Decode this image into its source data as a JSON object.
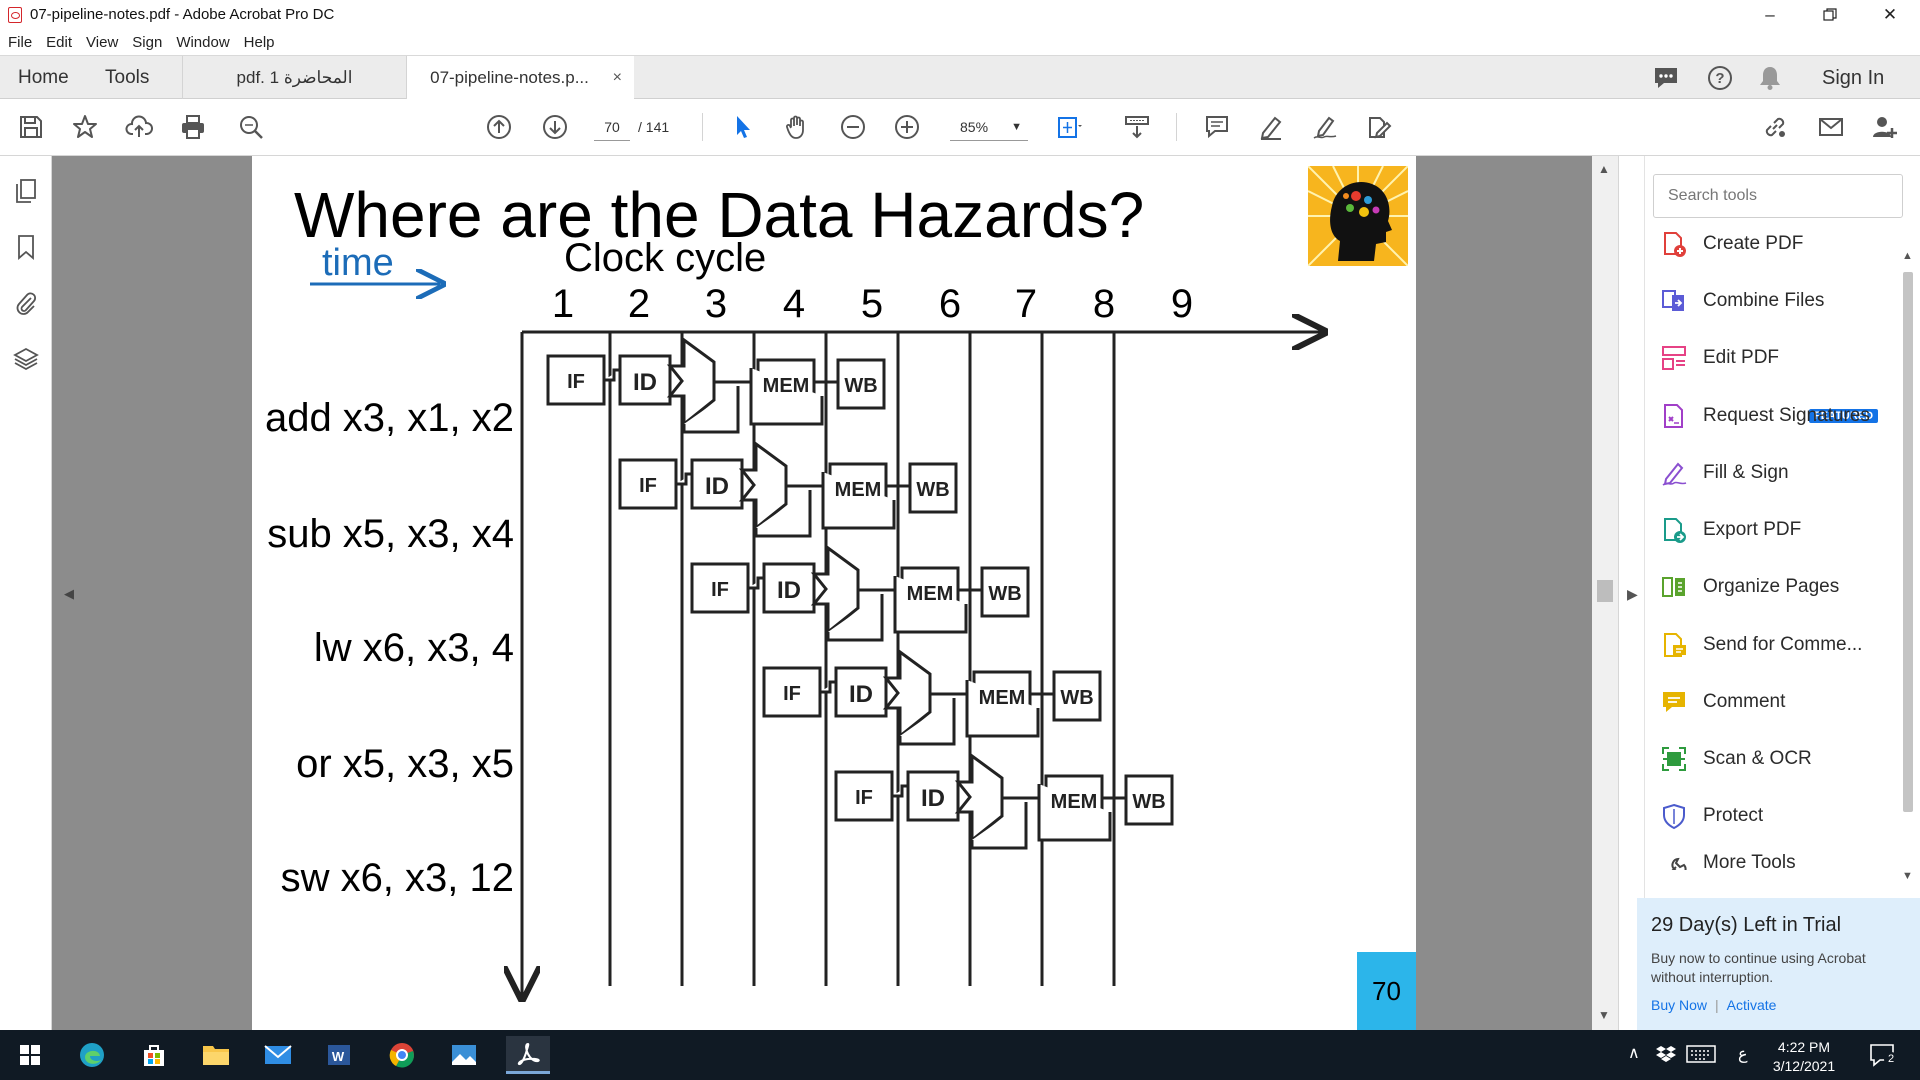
{
  "window": {
    "title": "07-pipeline-notes.pdf - Adobe Acrobat Pro DC"
  },
  "menu": [
    "File",
    "Edit",
    "View",
    "Sign",
    "Window",
    "Help"
  ],
  "tabs": {
    "home": "Home",
    "tools": "Tools",
    "doc1": "pdf. المحاضرة 1",
    "doc2": "07-pipeline-notes.p...",
    "close_glyph": "×",
    "sign_in": "Sign In"
  },
  "toolbar": {
    "page_current": "70",
    "page_total": "/ 141",
    "zoom": "85%"
  },
  "slide": {
    "title": "Where are the Data Hazards?",
    "time_label": "time",
    "clock_label": "Clock cycle",
    "cycles": [
      "1",
      "2",
      "3",
      "4",
      "5",
      "6",
      "7",
      "8",
      "9"
    ],
    "instructions": [
      "add x3, x1, x2",
      "sub x5, x3, x4",
      "lw x6, x3, 4",
      "or x5, x3, x5",
      "sw x6, x3, 12"
    ],
    "stages": {
      "if": "IF",
      "id": "ID",
      "mem": "MEM",
      "wb": "WB"
    },
    "page_number": "70"
  },
  "right_panel": {
    "search_placeholder": "Search tools",
    "featured_badge": "FEATURED",
    "tools": [
      {
        "label": "Create PDF",
        "icon": "create-pdf-icon",
        "color": "#e0403b"
      },
      {
        "label": "Combine Files",
        "icon": "combine-files-icon",
        "color": "#5b5bd6"
      },
      {
        "label": "Edit PDF",
        "icon": "edit-pdf-icon",
        "color": "#e64285"
      },
      {
        "label": "Request Signatures",
        "icon": "request-signatures-icon",
        "color": "#a13fc8"
      },
      {
        "label": "Fill & Sign",
        "icon": "fill-sign-icon",
        "color": "#8a4fd0"
      },
      {
        "label": "Export PDF",
        "icon": "export-pdf-icon",
        "color": "#1a9b8a"
      },
      {
        "label": "Organize Pages",
        "icon": "organize-pages-icon",
        "color": "#5aa32d"
      },
      {
        "label": "Send for Comme...",
        "icon": "send-for-comment-icon",
        "color": "#e6b400"
      },
      {
        "label": "Comment",
        "icon": "comment-icon",
        "color": "#e6b400"
      },
      {
        "label": "Scan & OCR",
        "icon": "scan-ocr-icon",
        "color": "#2e9b3e"
      },
      {
        "label": "Protect",
        "icon": "protect-icon",
        "color": "#4b5bcc"
      },
      {
        "label": "More Tools",
        "icon": "more-tools-icon",
        "color": "#444444"
      }
    ],
    "trial": {
      "title": "29 Day(s) Left in Trial",
      "text": "Buy now to continue using Acrobat without interruption.",
      "buy": "Buy Now",
      "activate": "Activate"
    }
  },
  "taskbar": {
    "time": "4:22 PM",
    "date": "3/12/2021",
    "lang": "ع",
    "notif_count": "2"
  },
  "colors": {
    "accent_blue": "#1473e6",
    "time_blue": "#1c6cb8",
    "page_badge": "#2cb5ea",
    "taskbar": "#101a24"
  }
}
